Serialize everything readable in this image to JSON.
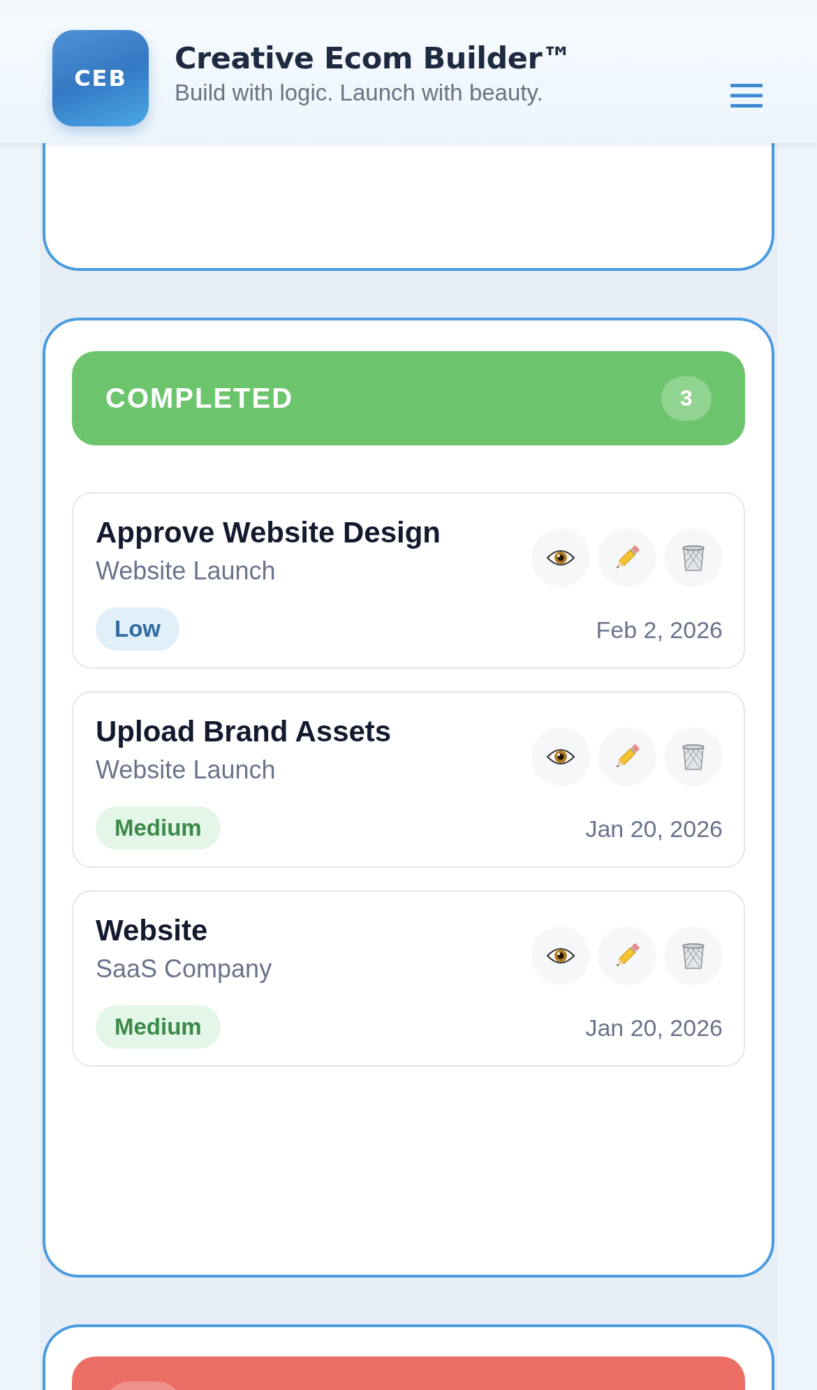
{
  "header": {
    "logo": "CEB",
    "title": "Creative Ecom Builder™",
    "tagline": "Build with logic. Launch with beauty."
  },
  "columns": [
    {
      "kind": "tail"
    },
    {
      "kind": "full",
      "title": "COMPLETED",
      "count": "3",
      "color": "#6cc56c",
      "tasks": [
        {
          "title": "Approve Website Design",
          "project": "Website Launch",
          "priority": {
            "label": "Low",
            "kind": "low"
          },
          "date": "Feb 2, 2026"
        },
        {
          "title": "Upload Brand Assets",
          "project": "Website Launch",
          "priority": {
            "label": "Medium",
            "kind": "medium"
          },
          "date": "Jan 20, 2026"
        },
        {
          "title": "Website",
          "project": "SaaS Company",
          "priority": {
            "label": "Medium",
            "kind": "medium"
          },
          "date": "Jan 20, 2026"
        }
      ]
    },
    {
      "kind": "head",
      "color": "#ec6d65"
    }
  ]
}
